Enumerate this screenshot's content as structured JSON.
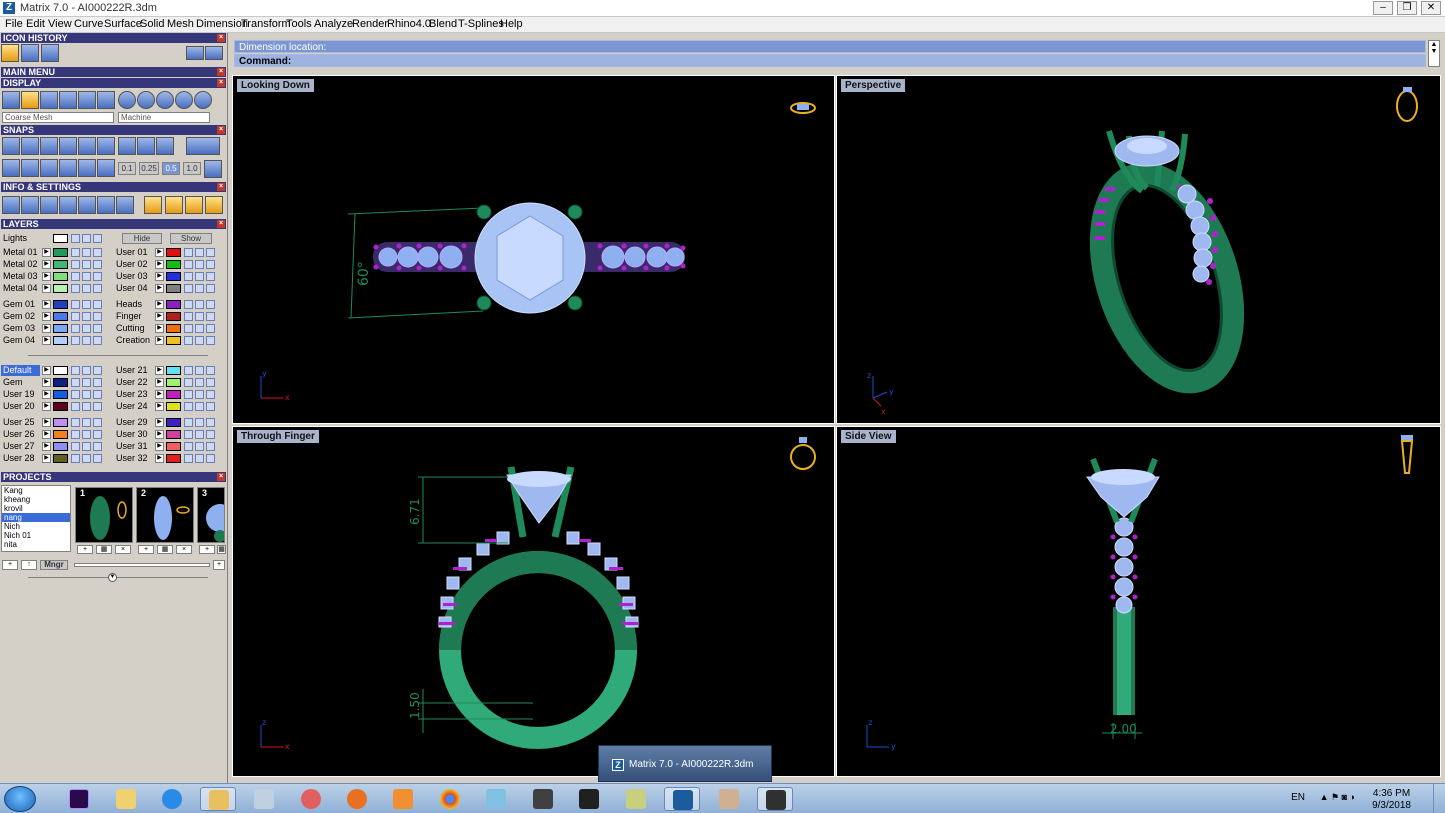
{
  "window": {
    "title": "Matrix 7.0 - AI000222R.3dm",
    "app_icon": "Z"
  },
  "menu": [
    "File",
    "Edit",
    "View",
    "Curve",
    "Surface",
    "Solid",
    "Mesh",
    "Dimension",
    "Transform",
    "Tools",
    "Analyze",
    "Render",
    "Rhino4.0",
    "Blend",
    "T-Splines",
    "Help"
  ],
  "panels": {
    "icon_history": "ICON HISTORY",
    "main_menu": "MAIN MENU",
    "display": "DISPLAY",
    "display_mesh": "Coarse Mesh",
    "display_material": "Machine",
    "snaps": "SNAPS",
    "snap_values": [
      "0.1",
      "0.25",
      "0.5",
      "1.0"
    ],
    "info": "INFO & SETTINGS",
    "layers": "LAYERS",
    "projects": "PROJECTS"
  },
  "layers": {
    "lights": "Lights",
    "hide": "Hide",
    "show": "Show",
    "group1": [
      {
        "left": "Metal 01",
        "lc": "#1f9a5a",
        "right": "User 01",
        "rc": "#e01010"
      },
      {
        "left": "Metal 02",
        "lc": "#3cb878",
        "right": "User 02",
        "rc": "#10c010"
      },
      {
        "left": "Metal 03",
        "lc": "#7ee07a",
        "right": "User 03",
        "rc": "#2030e0"
      },
      {
        "left": "Metal 04",
        "lc": "#b6f0b0",
        "right": "User 04",
        "rc": "#808080"
      }
    ],
    "group2": [
      {
        "left": "Gem 01",
        "lc": "#2040c0",
        "right": "Heads",
        "rc": "#8a20c0"
      },
      {
        "left": "Gem 02",
        "lc": "#4a78e8",
        "right": "Finger",
        "rc": "#b02020"
      },
      {
        "left": "Gem 03",
        "lc": "#7aa8f8",
        "right": "Cutting",
        "rc": "#f07010"
      },
      {
        "left": "Gem 04",
        "lc": "#b0d0ff",
        "right": "Creation",
        "rc": "#f0c020"
      }
    ],
    "group3": [
      {
        "left": "Default",
        "lc": "#ffffff",
        "right": "User 21",
        "rc": "#60e0f0"
      },
      {
        "left": "Gem",
        "lc": "#102080",
        "right": "User 22",
        "rc": "#a0f070"
      },
      {
        "left": "User 19",
        "lc": "#1060e0",
        "right": "User 23",
        "rc": "#c020c0"
      },
      {
        "left": "User 20",
        "lc": "#600020",
        "right": "User 24",
        "rc": "#e0e020"
      }
    ],
    "group4": [
      {
        "left": "User 25",
        "lc": "#c090f0",
        "right": "User 29",
        "rc": "#4020c0"
      },
      {
        "left": "User 26",
        "lc": "#f08020",
        "right": "User 30",
        "rc": "#d040a0"
      },
      {
        "left": "User 27",
        "lc": "#9090f0",
        "right": "User 31",
        "rc": "#f06060"
      },
      {
        "left": "User 28",
        "lc": "#606020",
        "right": "User 32",
        "rc": "#e02020"
      }
    ]
  },
  "projects": {
    "list": [
      "Kang",
      "kheang",
      "krovil",
      "nang",
      "Nich",
      "Nich 01",
      "nita"
    ],
    "selected": "nang",
    "thumb_numbers": [
      "1",
      "2",
      "3"
    ],
    "mngr": "Mngr"
  },
  "command": {
    "prompt1": "Dimension location:",
    "prompt2": "Command:"
  },
  "viewports": {
    "top_left": "Looking Down",
    "top_right": "Perspective",
    "bottom_left": "Through Finger",
    "bottom_right": "Side View",
    "dim_looking_down": "60°",
    "dim_height": "6.71",
    "dim_band": "1.50",
    "dim_width": "2.00",
    "axis_x": "x",
    "axis_y": "y",
    "axis_z": "z"
  },
  "taskbar": {
    "popup": "Matrix 7.0 - AI000222R.3dm",
    "lang": "EN",
    "time": "4:36 PM",
    "date": "9/3/2018"
  },
  "colors": {
    "metal": "#1e8a5a",
    "gem": "#9fb8f0",
    "prong_tip": "#8a1ec0",
    "accent": "#35377a",
    "viewport_label": "#a8b4cc"
  }
}
